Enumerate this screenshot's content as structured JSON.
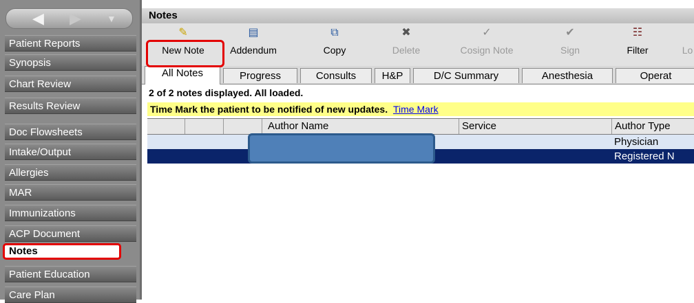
{
  "sidebar": {
    "items": [
      {
        "label": "Patient Reports"
      },
      {
        "label": "Synopsis"
      },
      {
        "label": "Chart Review"
      },
      {
        "label": "Results Review"
      },
      {
        "label": "Doc Flowsheets"
      },
      {
        "label": "Intake/Output"
      },
      {
        "label": "Allergies"
      },
      {
        "label": "MAR"
      },
      {
        "label": "Immunizations"
      },
      {
        "label": "ACP Document"
      },
      {
        "label": "Notes"
      },
      {
        "label": "Patient Education"
      },
      {
        "label": "Care Plan"
      }
    ],
    "active_label": "Notes"
  },
  "header": {
    "title": "Notes"
  },
  "toolbar": {
    "new_note": "New Note",
    "addendum": "Addendum",
    "copy": "Copy",
    "delete": "Delete",
    "cosign": "Cosign Note",
    "sign": "Sign",
    "filter": "Filter",
    "log": "Lo"
  },
  "tabs": [
    "All Notes",
    "Progress",
    "Consults",
    "H&P",
    "D/C Summary",
    "Anesthesia",
    "Operat"
  ],
  "status": {
    "text": "2 of 2 notes displayed. All loaded."
  },
  "time_mark": {
    "text": "Time Mark the patient to be notified of new updates.",
    "link": "Time Mark"
  },
  "table": {
    "columns": [
      "Author Name",
      "Service",
      "Author Type"
    ],
    "rows": [
      {
        "author_type": "Physician"
      },
      {
        "author_type": "Registered N"
      }
    ]
  },
  "colors": {
    "highlight": "#e30000",
    "selected_row": "#0a246a",
    "time_mark_bg": "#ffff88"
  },
  "icons": {
    "new_note": "new-note-icon",
    "addendum": "addendum-icon",
    "copy": "copy-icon",
    "delete": "delete-icon",
    "cosign": "cosign-icon",
    "sign": "sign-icon",
    "filter": "filter-icon"
  }
}
